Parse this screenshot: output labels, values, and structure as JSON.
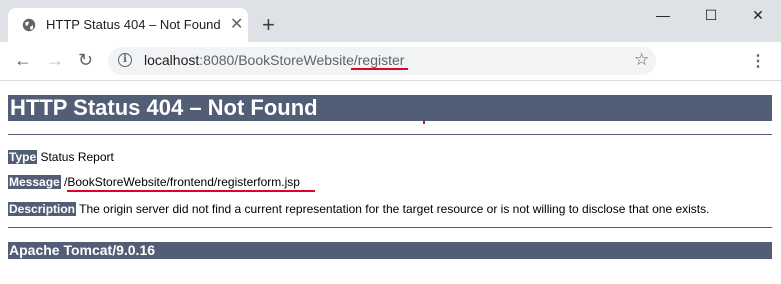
{
  "browser": {
    "tab_title": "HTTP Status 404 – Not Found",
    "tab_close": "✕",
    "new_tab": "+",
    "url_host": "localhost",
    "url_rest": ":8080/BookStoreWebsite/register",
    "controls": {
      "minimize": "—",
      "maximize": "☐",
      "close": "✕"
    },
    "nav": {
      "back": "←",
      "forward": "→",
      "reload": "↻"
    }
  },
  "page": {
    "title": "HTTP Status 404 – Not Found",
    "type_label": "Type",
    "type_value": " Status Report",
    "message_label": "Message",
    "message_value": " /BookStoreWebsite/frontend/registerform.jsp",
    "description_label": "Description",
    "description_value": " The origin server did not find a current representation for the target resource or is not willing to disclose that one exists.",
    "footer": "Apache Tomcat/9.0.16"
  },
  "colors": {
    "banner": "#525d76",
    "annotation": "#e0002a"
  }
}
